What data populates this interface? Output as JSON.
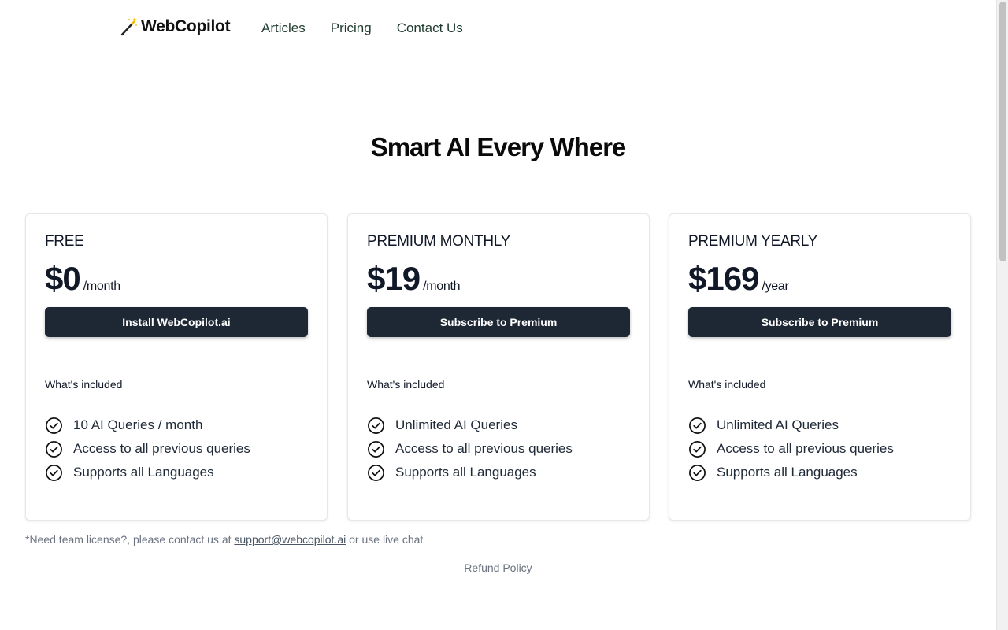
{
  "header": {
    "logo_text": "WebCopilot",
    "nav": [
      "Articles",
      "Pricing",
      "Contact Us"
    ]
  },
  "hero": {
    "title": "Smart AI Every Where"
  },
  "plans": [
    {
      "name": "FREE",
      "price": "$0",
      "period": "/month",
      "button": "Install WebCopilot.ai",
      "included_label": "What's included",
      "features": [
        "10 AI Queries / month",
        "Access to all previous queries",
        "Supports all Languages"
      ]
    },
    {
      "name": "PREMIUM MONTHLY",
      "price": "$19",
      "period": "/month",
      "button": "Subscribe to Premium",
      "included_label": "What's included",
      "features": [
        "Unlimited AI Queries",
        "Access to all previous queries",
        "Supports all Languages"
      ]
    },
    {
      "name": "PREMIUM YEARLY",
      "price": "$169",
      "period": "/year",
      "button": "Subscribe to Premium",
      "included_label": "What's included",
      "features": [
        "Unlimited AI Queries",
        "Access to all previous queries",
        "Supports all Languages"
      ]
    }
  ],
  "footer": {
    "note_prefix": "*Need team license?, please contact us at ",
    "note_email": "support@webcopilot.ai",
    "note_suffix": " or use live chat",
    "refund_link": "Refund Policy"
  },
  "colors": {
    "button_bg": "#1e2834",
    "nav_text": "#1f3a2e",
    "accent_wand": "#f5b800"
  },
  "icons": {
    "logo": "magic-wand-icon",
    "feature": "check-circle-icon"
  }
}
